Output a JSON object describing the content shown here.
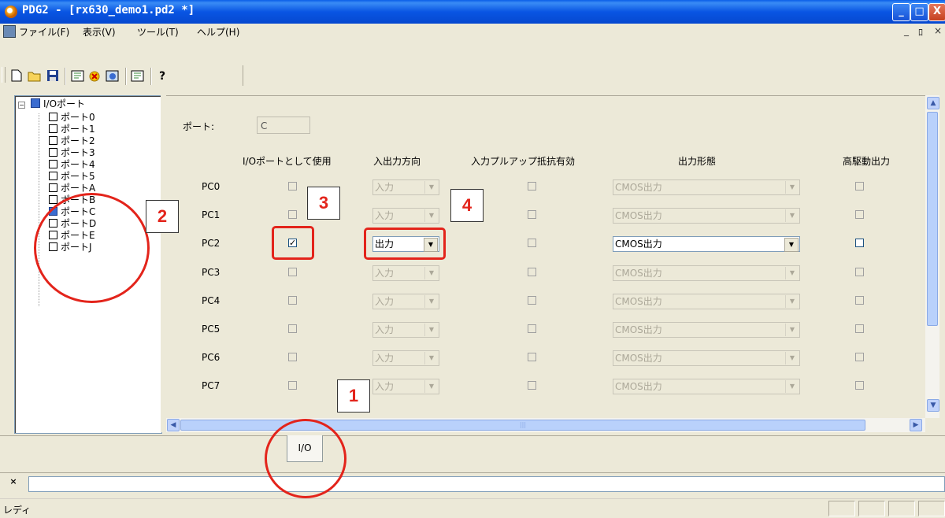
{
  "window": {
    "title": "PDG2 - [rx630_demo1.pd2 *]",
    "controls": [
      "_",
      "□",
      "X"
    ]
  },
  "menu": {
    "items": [
      "ファイル(F)",
      "表示(V)",
      "ツール(T)",
      "ヘルプ(H)"
    ],
    "mdi_controls": [
      "_",
      "ﾛ",
      "×"
    ]
  },
  "toolbar": {
    "buttons": [
      "new-icon",
      "open-icon",
      "save-icon",
      "build-icon",
      "generate-icon",
      "check-icon",
      "sheet-icon",
      "help-icon"
    ],
    "help_glyph": "?"
  },
  "tree": {
    "root": "I/Oポート",
    "items": [
      "ポート0",
      "ポート1",
      "ポート2",
      "ポート3",
      "ポート4",
      "ポート5",
      "ポートA",
      "ポートB",
      "ポートC",
      "ポートD",
      "ポートE",
      "ポートJ"
    ],
    "selected": "ポートC"
  },
  "form": {
    "port_label": "ポート:",
    "port_value": "C",
    "headers": {
      "use_io": "I/Oポートとして使用",
      "direction": "入出力方向",
      "pullup": "入力プルアップ抵抗有効",
      "output_type": "出力形態",
      "high_drive": "高駆動出力"
    },
    "rows": [
      {
        "pin": "PC0",
        "use_io": false,
        "direction": "入力",
        "output_type": "CMOS出力",
        "enabled": false
      },
      {
        "pin": "PC1",
        "use_io": false,
        "direction": "入力",
        "output_type": "CMOS出力",
        "enabled": false
      },
      {
        "pin": "PC2",
        "use_io": true,
        "direction": "出力",
        "output_type": "CMOS出力",
        "enabled": true
      },
      {
        "pin": "PC3",
        "use_io": false,
        "direction": "入力",
        "output_type": "CMOS出力",
        "enabled": false
      },
      {
        "pin": "PC4",
        "use_io": false,
        "direction": "入力",
        "output_type": "CMOS出力",
        "enabled": false
      },
      {
        "pin": "PC5",
        "use_io": false,
        "direction": "入力",
        "output_type": "CMOS出力",
        "enabled": false
      },
      {
        "pin": "PC6",
        "use_io": false,
        "direction": "入力",
        "output_type": "CMOS出力",
        "enabled": false
      },
      {
        "pin": "PC7",
        "use_io": false,
        "direction": "入力",
        "output_type": "CMOS出力",
        "enabled": false
      }
    ]
  },
  "tabs": {
    "io": "I/O"
  },
  "status": {
    "text": "レディ"
  },
  "annotations": {
    "labels": [
      "1",
      "2",
      "3",
      "4"
    ],
    "color": "#e3241b"
  },
  "colors": {
    "titlebar": "#0a5ee8",
    "face": "#ece9d8",
    "annotation": "#e3241b"
  }
}
